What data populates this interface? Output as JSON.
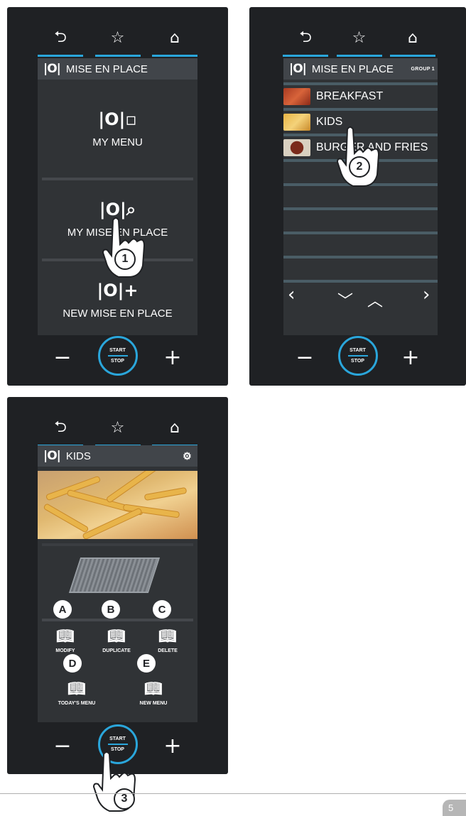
{
  "icons": {
    "back": "back-icon",
    "favourite": "star-icon",
    "home": "home-icon"
  },
  "accent_color": "#2aa6db",
  "controls": {
    "minus": "−",
    "plus": "+",
    "start": "START",
    "stop": "STOP"
  },
  "panel1": {
    "header": "MISE EN PLACE",
    "tiles": [
      {
        "label": "MY MENU"
      },
      {
        "label": "MY MISE EN PLACE"
      },
      {
        "label": "NEW MISE EN PLACE"
      }
    ],
    "step": "1"
  },
  "panel2": {
    "header": "MISE EN PLACE",
    "badge": "GROUP 1",
    "items": [
      "BREAKFAST",
      "KIDS",
      "BURGER AND FRIES"
    ],
    "step": "2"
  },
  "panel3": {
    "header": "KIDS",
    "actions_top": [
      {
        "letter": "A",
        "label": "MODIFY"
      },
      {
        "letter": "B",
        "label": "DUPLICATE"
      },
      {
        "letter": "C",
        "label": "DELETE"
      }
    ],
    "actions_bottom": [
      {
        "letter": "D",
        "label": "TODAY'S MENU"
      },
      {
        "letter": "E",
        "label": "NEW MENU"
      }
    ],
    "step": "3"
  },
  "page_number": "5"
}
